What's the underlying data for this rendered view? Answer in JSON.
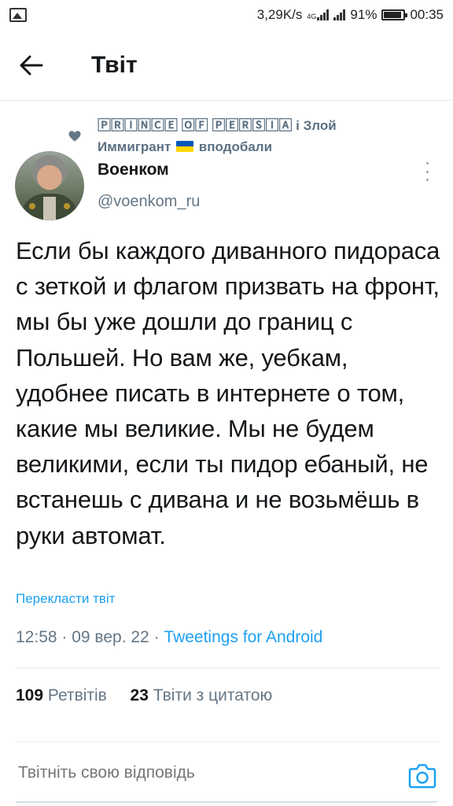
{
  "status_bar": {
    "speed": "3,29K/s",
    "network": "4G",
    "battery": "91%",
    "battery_level": 0.91,
    "time": "00:35"
  },
  "header": {
    "title": "Твіт"
  },
  "social_context": {
    "text_user": "🄿🅁🄸🄽🄲🄴 🄾🄵 🄿🄴🅁🅂🄸🄰",
    "text_mid": " і Злой Иммигрант ",
    "text_end": " вподобали",
    "flag_colors": [
      "#0057b7",
      "#ffd700"
    ]
  },
  "tweet": {
    "author_name": "Военком",
    "author_handle": "@voenkom_ru",
    "text": "Если бы каждого диванного пидораса с зеткой и флагом призвать на фронт, мы бы уже дошли до границ с Польшей. Но вам же, уебкам, удобнее писать в интернете о том, какие мы великие. Мы не будем великими, если ты пидор ебаный, не встанешь с дивана и не возьмёшь в руки автомат.",
    "translate_label": "Перекласти твіт",
    "time": "12:58",
    "date": "09 вер. 22",
    "client": "Tweetings for Android",
    "retweets_count": "109",
    "retweets_label": "Ретвітів",
    "quotes_count": "23",
    "quotes_label": "Твіти з цитатою"
  },
  "reply": {
    "placeholder": "Твітніть свою відповідь"
  },
  "colors": {
    "accent": "#1da1f2",
    "secondary_text": "#657786",
    "primary_text": "#14171a"
  }
}
